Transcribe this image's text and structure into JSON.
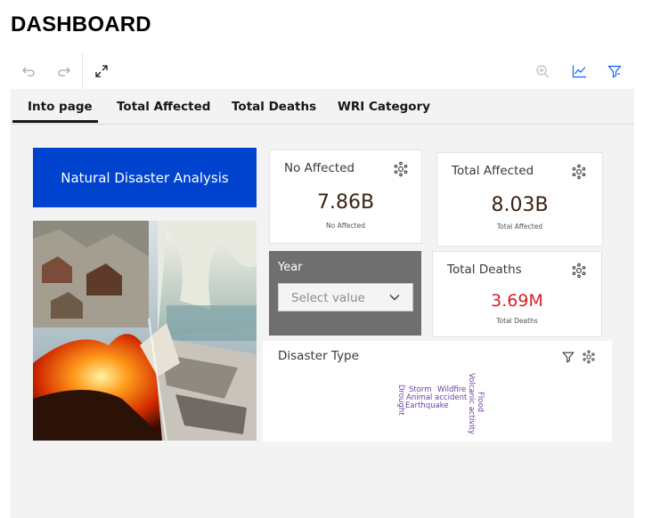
{
  "page": {
    "title": "DASHBOARD"
  },
  "toolbar": {
    "undo_icon": "undo-icon",
    "redo_icon": "redo-icon",
    "expand_icon": "expand-icon",
    "zoom_icon": "zoom-in-icon",
    "insights_icon": "trend-chart-icon",
    "filter_icon": "filter-icon"
  },
  "tabs": [
    {
      "label": "Into page",
      "active": true
    },
    {
      "label": "Total Affected",
      "active": false
    },
    {
      "label": "Total Deaths",
      "active": false
    },
    {
      "label": "WRI Category",
      "active": false
    }
  ],
  "banner": {
    "text": "Natural Disaster Analysis",
    "color": "#0043ce"
  },
  "cards": {
    "no_affected": {
      "title": "No Affected",
      "value": "7.86B",
      "caption": "No Affected"
    },
    "total_affected": {
      "title": "Total Affected",
      "value": "8.03B",
      "caption": "Total Affected"
    },
    "total_deaths": {
      "title": "Total Deaths",
      "value": "3.69M",
      "caption": "Total Deaths",
      "value_color": "#da1e28"
    }
  },
  "year_filter": {
    "title": "Year",
    "placeholder": "Select value"
  },
  "disaster_type": {
    "title": "Disaster Type",
    "words": [
      "Storm",
      "Wildfire",
      "Animal accident",
      "Earthquake",
      "Drought",
      "Volcanic activity",
      "Flood"
    ]
  }
}
